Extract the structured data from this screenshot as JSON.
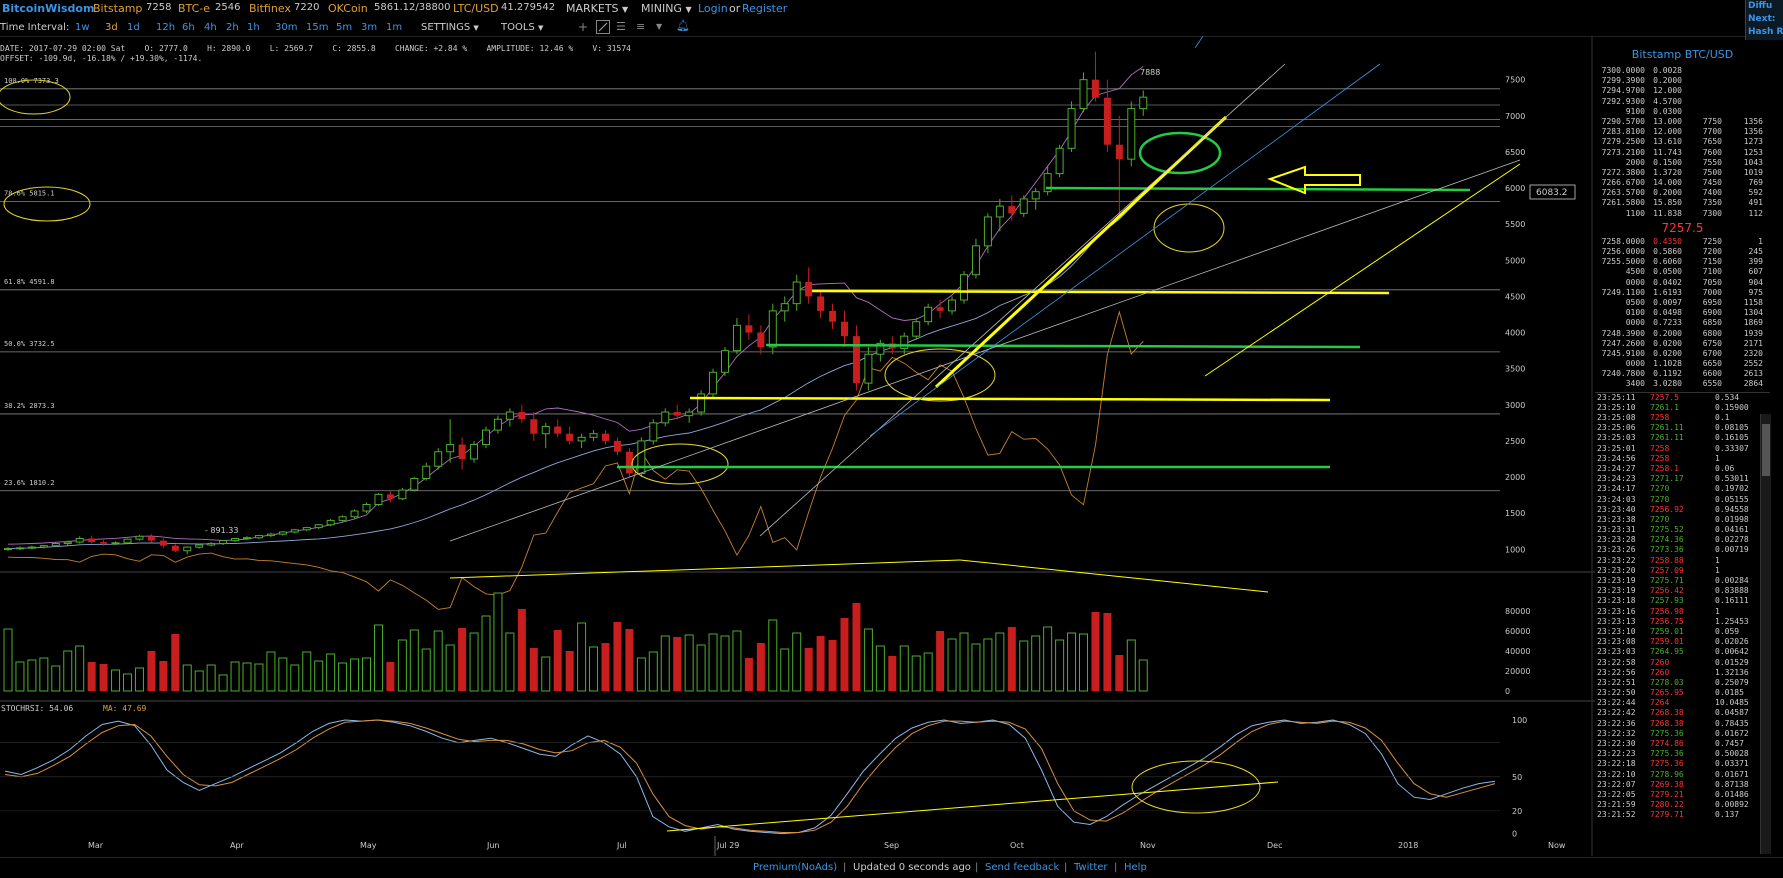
{
  "header": {
    "brand": "BitcoinWisdom",
    "tickers": [
      {
        "exchange": "Bitstamp",
        "value": "7258"
      },
      {
        "exchange": "BTC-e",
        "value": "2546"
      },
      {
        "exchange": "Bitfinex",
        "value": "7220"
      },
      {
        "exchange": "OKCoin",
        "value": "5861.12/38800"
      },
      {
        "exchange": "LTC/USD",
        "value": "41.279542"
      }
    ],
    "menus": {
      "markets": "MARKETS",
      "mining": "MINING"
    },
    "login": "Login",
    "or": "or",
    "register": "Register",
    "side_labels": [
      "Diffu",
      "Next:",
      "Hash R"
    ]
  },
  "toolbar": {
    "time_interval_label": "Time Interval:",
    "intervals": [
      "1w",
      "3d",
      "1d",
      "12h",
      "6h",
      "4h",
      "2h",
      "1h",
      "30m",
      "15m",
      "5m",
      "3m",
      "1m"
    ],
    "active_interval": "3d",
    "settings": "SETTINGS",
    "tools": "TOOLS"
  },
  "infobar": {
    "line1": "DATE: 2017-07-29 02:00 Sat    O: 2777.0    H: 2890.0    L: 2569.7    C: 2855.8    CHANGE: +2.84 %    AMPLITUDE: 12.46 %    V: 31574",
    "line2": "OFFSET: -109.9d, -16.18% / +19.30%, -1174."
  },
  "chart_data": {
    "type": "candlestick",
    "price_axis": {
      "ticks": [
        "7500",
        "7000",
        "6500",
        "6000",
        "5500",
        "5000",
        "4500",
        "4000",
        "3500",
        "3000",
        "2500",
        "2000",
        "1500",
        "1000"
      ]
    },
    "volume_axis": {
      "ticks": [
        "80000",
        "60000",
        "40000",
        "20000",
        "0"
      ]
    },
    "stoch_axis": {
      "ticks": [
        "100",
        "50",
        "20",
        "0"
      ]
    },
    "x_ticks": [
      "Mar",
      "Apr",
      "May",
      "Jun",
      "Jul",
      "Jul 29",
      "Sep",
      "Oct",
      "Nov",
      "Dec",
      "2018",
      "Now"
    ],
    "fib_levels": [
      {
        "label": "100.0% 7373.3",
        "value": 7373.3
      },
      {
        "label": "78.6% 5815.1",
        "value": 5815.1
      },
      {
        "label": "61.8% 4591.8",
        "value": 4591.8
      },
      {
        "label": "50.0% 3732.5",
        "value": 3732.5
      },
      {
        "label": "38.2% 2873.3",
        "value": 2873.3
      },
      {
        "label": "23.6% 1810.2",
        "value": 1810.2
      }
    ],
    "high_label": "7888",
    "low_label": "891.33",
    "current_price_tag": "6083.2",
    "stochrsi_label": "STOCHRSI: 54.06",
    "ma_label": "MA: 47.69",
    "candles": [
      [
        1000,
        1030,
        980,
        1010
      ],
      [
        1010,
        1040,
        990,
        1020
      ],
      [
        1020,
        1050,
        1000,
        1030
      ],
      [
        1030,
        1060,
        1010,
        1050
      ],
      [
        1050,
        1100,
        1030,
        1080
      ],
      [
        1080,
        1120,
        1050,
        1100
      ],
      [
        1100,
        1180,
        1080,
        1150
      ],
      [
        1150,
        1190,
        1080,
        1100
      ],
      [
        1100,
        1130,
        1050,
        1080
      ],
      [
        1080,
        1110,
        1060,
        1090
      ],
      [
        1090,
        1150,
        1080,
        1140
      ],
      [
        1140,
        1200,
        1120,
        1180
      ],
      [
        1180,
        1210,
        1100,
        1120
      ],
      [
        1120,
        1150,
        1020,
        1050
      ],
      [
        1050,
        1070,
        960,
        980
      ],
      [
        980,
        1040,
        930,
        1030
      ],
      [
        1030,
        1080,
        1010,
        1060
      ],
      [
        1060,
        1100,
        1040,
        1080
      ],
      [
        1080,
        1130,
        1060,
        1120
      ],
      [
        1120,
        1160,
        1100,
        1150
      ],
      [
        1150,
        1180,
        1130,
        1160
      ],
      [
        1160,
        1200,
        1140,
        1190
      ],
      [
        1190,
        1230,
        1170,
        1210
      ],
      [
        1210,
        1250,
        1190,
        1240
      ],
      [
        1240,
        1280,
        1220,
        1270
      ],
      [
        1270,
        1310,
        1250,
        1300
      ],
      [
        1300,
        1350,
        1280,
        1340
      ],
      [
        1340,
        1420,
        1320,
        1400
      ],
      [
        1400,
        1470,
        1380,
        1450
      ],
      [
        1450,
        1550,
        1430,
        1530
      ],
      [
        1530,
        1650,
        1500,
        1620
      ],
      [
        1620,
        1780,
        1600,
        1760
      ],
      [
        1760,
        1800,
        1650,
        1700
      ],
      [
        1700,
        1850,
        1680,
        1820
      ],
      [
        1820,
        2000,
        1800,
        1980
      ],
      [
        1980,
        2200,
        1950,
        2150
      ],
      [
        2150,
        2400,
        2100,
        2350
      ],
      [
        2350,
        2800,
        2200,
        2450
      ],
      [
        2450,
        2550,
        2100,
        2250
      ],
      [
        2250,
        2500,
        2200,
        2450
      ],
      [
        2450,
        2700,
        2400,
        2650
      ],
      [
        2650,
        2850,
        2600,
        2800
      ],
      [
        2800,
        2950,
        2700,
        2900
      ],
      [
        2900,
        3000,
        2750,
        2800
      ],
      [
        2800,
        2900,
        2500,
        2600
      ],
      [
        2600,
        2750,
        2400,
        2700
      ],
      [
        2700,
        2800,
        2550,
        2600
      ],
      [
        2600,
        2700,
        2450,
        2500
      ],
      [
        2500,
        2600,
        2400,
        2550
      ],
      [
        2550,
        2650,
        2500,
        2600
      ],
      [
        2600,
        2650,
        2450,
        2500
      ],
      [
        2500,
        2550,
        2300,
        2350
      ],
      [
        2350,
        2400,
        2000,
        2050
      ],
      [
        2050,
        2550,
        2000,
        2500
      ],
      [
        2500,
        2800,
        2450,
        2750
      ],
      [
        2750,
        2950,
        2700,
        2900
      ],
      [
        2900,
        3000,
        2800,
        2850
      ],
      [
        2850,
        2950,
        2750,
        2900
      ],
      [
        2900,
        3200,
        2850,
        3150
      ],
      [
        3150,
        3500,
        3100,
        3450
      ],
      [
        3450,
        3800,
        3400,
        3750
      ],
      [
        3750,
        4200,
        3700,
        4100
      ],
      [
        4100,
        4250,
        3900,
        4000
      ],
      [
        4000,
        4100,
        3700,
        3800
      ],
      [
        3800,
        4400,
        3700,
        4300
      ],
      [
        4300,
        4500,
        4150,
        4400
      ],
      [
        4400,
        4800,
        4300,
        4700
      ],
      [
        4700,
        4900,
        4400,
        4500
      ],
      [
        4500,
        4600,
        4200,
        4300
      ],
      [
        4300,
        4400,
        4050,
        4150
      ],
      [
        4150,
        4300,
        3800,
        3950
      ],
      [
        3950,
        4100,
        3200,
        3300
      ],
      [
        3300,
        3800,
        3200,
        3700
      ],
      [
        3700,
        3900,
        3600,
        3850
      ],
      [
        3850,
        3950,
        3700,
        3780
      ],
      [
        3780,
        4000,
        3700,
        3950
      ],
      [
        3950,
        4200,
        3900,
        4150
      ],
      [
        4150,
        4400,
        4100,
        4350
      ],
      [
        4350,
        4450,
        4200,
        4300
      ],
      [
        4300,
        4500,
        4250,
        4450
      ],
      [
        4450,
        4850,
        4400,
        4800
      ],
      [
        4800,
        5300,
        4750,
        5200
      ],
      [
        5200,
        5650,
        5100,
        5600
      ],
      [
        5600,
        5850,
        5400,
        5750
      ],
      [
        5750,
        5900,
        5550,
        5650
      ],
      [
        5650,
        5900,
        5600,
        5850
      ],
      [
        5850,
        6000,
        5700,
        5950
      ],
      [
        5950,
        6300,
        5900,
        6200
      ],
      [
        6200,
        6600,
        6150,
        6550
      ],
      [
        6550,
        7200,
        6500,
        7100
      ],
      [
        7100,
        7600,
        7050,
        7500
      ],
      [
        7500,
        7888,
        7200,
        7250
      ],
      [
        7250,
        7500,
        6500,
        6600
      ],
      [
        6600,
        7000,
        5600,
        6400
      ],
      [
        6400,
        7200,
        6300,
        7100
      ],
      [
        7100,
        7350,
        7000,
        7258
      ]
    ],
    "volumes": [
      62000,
      29000,
      31000,
      33000,
      25000,
      40000,
      45000,
      29000,
      27000,
      21000,
      17000,
      23000,
      40000,
      30000,
      57000,
      26000,
      20000,
      26000,
      16000,
      29000,
      28000,
      27000,
      39000,
      33000,
      26000,
      39000,
      30000,
      37000,
      28000,
      32000,
      33000,
      66000,
      29000,
      51000,
      61000,
      42000,
      60000,
      46000,
      63000,
      58000,
      75000,
      98000,
      58000,
      82000,
      43000,
      34000,
      61000,
      40000,
      68000,
      44000,
      48000,
      69000,
      62000,
      33000,
      39000,
      55000,
      54000,
      56000,
      46000,
      57000,
      55000,
      60000,
      33000,
      48000,
      71000,
      42000,
      58000,
      43000,
      55000,
      51000,
      73000,
      88000,
      62000,
      45000,
      35000,
      45000,
      35000,
      38000,
      60000,
      52000,
      58000,
      47000,
      52000,
      58000,
      64000,
      50000,
      55000,
      64000,
      51000,
      58000,
      57000,
      79000,
      78000,
      36000,
      51000,
      31000
    ],
    "stoch_k": [
      55,
      52,
      58,
      65,
      74,
      86,
      96,
      99,
      95,
      78,
      56,
      45,
      38,
      44,
      50,
      57,
      64,
      71,
      80,
      90,
      97,
      100,
      99,
      100,
      98,
      95,
      90,
      84,
      80,
      82,
      84,
      80,
      75,
      70,
      68,
      78,
      86,
      80,
      70,
      50,
      15,
      6,
      2,
      5,
      8,
      4,
      2,
      1,
      0,
      1,
      5,
      16,
      35,
      55,
      70,
      84,
      93,
      98,
      100,
      97,
      98,
      100,
      96,
      84,
      56,
      24,
      10,
      8,
      15,
      25,
      34,
      42,
      50,
      58,
      66,
      76,
      87,
      95,
      98,
      100,
      97,
      98,
      100,
      96,
      88,
      70,
      44,
      32,
      30,
      35,
      40,
      44,
      46
    ],
    "stoch_d": [
      52,
      50,
      53,
      60,
      68,
      79,
      89,
      95,
      96,
      86,
      68,
      52,
      43,
      42,
      45,
      52,
      59,
      66,
      74,
      84,
      92,
      98,
      99,
      100,
      99,
      97,
      93,
      88,
      83,
      81,
      82,
      82,
      79,
      74,
      71,
      73,
      80,
      82,
      76,
      62,
      35,
      15,
      7,
      4,
      6,
      5,
      3,
      2,
      1,
      1,
      3,
      10,
      24,
      44,
      61,
      76,
      88,
      95,
      99,
      99,
      98,
      99,
      98,
      92,
      75,
      44,
      20,
      12,
      11,
      18,
      27,
      36,
      44,
      52,
      60,
      69,
      80,
      90,
      96,
      99,
      98,
      97,
      99,
      98,
      93,
      82,
      62,
      44,
      35,
      32,
      36,
      40,
      44
    ]
  },
  "orderbook": {
    "title": "Bitstamp BTC/USD",
    "asks": [
      [
        "7300.0000",
        "0.0028",
        "",
        ""
      ],
      [
        "7299.3900",
        "0.2000",
        "",
        ""
      ],
      [
        "7294.9700",
        "12.000",
        "",
        ""
      ],
      [
        "7292.9300",
        "4.5700",
        "",
        ""
      ],
      [
        "9100",
        "0.0300",
        "",
        ""
      ],
      [
        "7290.5700",
        "13.000",
        "7750",
        "1356"
      ],
      [
        "7283.8100",
        "12.000",
        "7700",
        "1356"
      ],
      [
        "7279.2500",
        "13.610",
        "7650",
        "1273"
      ],
      [
        "7273.2100",
        "11.743",
        "7600",
        "1253"
      ],
      [
        "2000",
        "0.1500",
        "7550",
        "1043"
      ],
      [
        "7272.3800",
        "1.3720",
        "7500",
        "1019"
      ],
      [
        "7266.6700",
        "14.000",
        "7450",
        "769"
      ],
      [
        "7263.5700",
        "0.2000",
        "7400",
        "592"
      ],
      [
        "7261.5800",
        "15.850",
        "7350",
        "491"
      ],
      [
        "1100",
        "11.838",
        "7300",
        "112"
      ]
    ],
    "last_price": "7257.5",
    "bids": [
      [
        "7258.0000",
        "0.4350",
        "7250",
        "1"
      ],
      [
        "7256.0000",
        "0.5860",
        "7200",
        "245"
      ],
      [
        "7255.5000",
        "0.6060",
        "7150",
        "399"
      ],
      [
        "4500",
        "0.0500",
        "7100",
        "607"
      ],
      [
        "0000",
        "0.0402",
        "7050",
        "904"
      ],
      [
        "7249.1100",
        "1.6193",
        "7000",
        "975"
      ],
      [
        "0500",
        "0.0097",
        "6950",
        "1158"
      ],
      [
        "0100",
        "0.0498",
        "6900",
        "1304"
      ],
      [
        "0000",
        "0.7233",
        "6850",
        "1869"
      ],
      [
        "7248.3900",
        "0.2000",
        "6800",
        "1939"
      ],
      [
        "7247.2600",
        "0.0200",
        "6750",
        "2171"
      ],
      [
        "7245.9100",
        "0.0200",
        "6700",
        "2320"
      ],
      [
        "0000",
        "1.1028",
        "6650",
        "2552"
      ],
      [
        "7240.7800",
        "0.1192",
        "6600",
        "2613"
      ],
      [
        "3400",
        "3.0280",
        "6550",
        "2864"
      ]
    ]
  },
  "trades": [
    [
      "23:25:11",
      "7257.5",
      "0.534",
      "r"
    ],
    [
      "23:25:10",
      "7261.1",
      "0.15900",
      "g"
    ],
    [
      "23:25:08",
      "7258",
      "0.1",
      "r"
    ],
    [
      "23:25:06",
      "7261.11",
      "0.08105",
      "g"
    ],
    [
      "23:25:03",
      "7261.11",
      "0.16105",
      "g"
    ],
    [
      "23:25:01",
      "7258",
      "0.33307",
      "r"
    ],
    [
      "23:24:56",
      "7258",
      "1",
      "r"
    ],
    [
      "23:24:27",
      "7258.1",
      "0.06",
      "r"
    ],
    [
      "23:24:23",
      "7271.17",
      "0.53011",
      "g"
    ],
    [
      "23:24:17",
      "7270",
      "0.19702",
      "g"
    ],
    [
      "23:24:03",
      "7270",
      "0.05155",
      "g"
    ],
    [
      "23:23:40",
      "7256.92",
      "0.94558",
      "r"
    ],
    [
      "23:23:38",
      "7270",
      "0.01998",
      "g"
    ],
    [
      "23:23:31",
      "7275.52",
      "0.04161",
      "g"
    ],
    [
      "23:23:28",
      "7274.36",
      "0.02278",
      "g"
    ],
    [
      "23:23:26",
      "7273.36",
      "0.00719",
      "g"
    ],
    [
      "23:23:22",
      "7258.88",
      "1",
      "r"
    ],
    [
      "23:23:20",
      "7257.09",
      "1",
      "r"
    ],
    [
      "23:23:19",
      "7275.71",
      "0.00284",
      "g"
    ],
    [
      "23:23:19",
      "7256.42",
      "0.83888",
      "r"
    ],
    [
      "23:23:18",
      "7257.93",
      "0.16111",
      "g"
    ],
    [
      "23:23:16",
      "7256.98",
      "1",
      "r"
    ],
    [
      "23:23:13",
      "7256.75",
      "1.25453",
      "r"
    ],
    [
      "23:23:10",
      "7259.01",
      "0.059",
      "g"
    ],
    [
      "23:23:08",
      "7259.01",
      "0.02026",
      "r"
    ],
    [
      "23:23:03",
      "7264.95",
      "0.00642",
      "g"
    ],
    [
      "23:22:58",
      "7260",
      "0.01529",
      "r"
    ],
    [
      "23:22:56",
      "7260",
      "1.32136",
      "r"
    ],
    [
      "23:22:51",
      "7278.03",
      "0.25079",
      "g"
    ],
    [
      "23:22:50",
      "7265.95",
      "0.0185",
      "r"
    ],
    [
      "23:22:44",
      "7264",
      "10.0485",
      "r"
    ],
    [
      "23:22:42",
      "7268.38",
      "0.04587",
      "r"
    ],
    [
      "23:22:36",
      "7268.38",
      "0.78435",
      "r"
    ],
    [
      "23:22:32",
      "7275.36",
      "0.01672",
      "g"
    ],
    [
      "23:22:30",
      "7274.86",
      "0.7457",
      "r"
    ],
    [
      "23:22:23",
      "7275.36",
      "0.50028",
      "g"
    ],
    [
      "23:22:18",
      "7275.36",
      "0.03371",
      "r"
    ],
    [
      "23:22:10",
      "7278.96",
      "0.01671",
      "g"
    ],
    [
      "23:22:07",
      "7269.38",
      "0.87138",
      "r"
    ],
    [
      "23:22:05",
      "7279.21",
      "0.01486",
      "r"
    ],
    [
      "23:21:59",
      "7280.22",
      "0.00892",
      "r"
    ],
    [
      "23:21:52",
      "7279.71",
      "0.137",
      "r"
    ]
  ],
  "footer": {
    "premium": "Premium(NoAds)",
    "updated": "Updated 0 seconds ago",
    "feedback": "Send feedback",
    "twitter": "Twitter",
    "help": "Help"
  },
  "colors": {
    "up": "#4caf2a",
    "down": "#c81e1e",
    "accent": "#3b95e6",
    "orange": "#e0a03a",
    "annotation_yellow": "#ffff00",
    "annotation_green": "#22cc44"
  }
}
